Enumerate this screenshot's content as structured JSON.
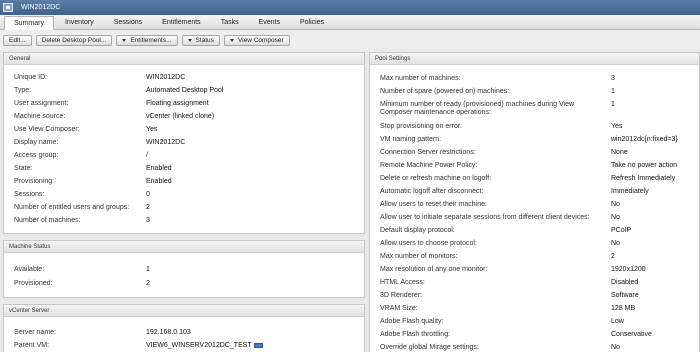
{
  "window": {
    "title": "WIN2012DC"
  },
  "tabs": [
    "Summary",
    "Inventory",
    "Sessions",
    "Entitlements",
    "Tasks",
    "Events",
    "Policies"
  ],
  "toolbar": {
    "edit": "Edit...",
    "delete": "Delete Desktop Pool...",
    "entitlements": "Entitlements...",
    "status": "Status",
    "composer": "View Composer"
  },
  "general": {
    "header": "General",
    "rows": [
      {
        "label": "Unique ID:",
        "value": "WIN2012DC"
      },
      {
        "label": "Type:",
        "value": "Automated Desktop Pool"
      },
      {
        "label": "User assignment:",
        "value": "Floating assignment"
      },
      {
        "label": "Machine source:",
        "value": "vCenter (linked clone)"
      },
      {
        "label": "Use View Composer:",
        "value": "Yes"
      },
      {
        "label": "Display name:",
        "value": "WIN2012DC"
      },
      {
        "label": "Access group:",
        "value": "/"
      },
      {
        "label": "State:",
        "value": "Enabled"
      },
      {
        "label": "Provisioning:",
        "value": "Enabled"
      },
      {
        "label": "Sessions:",
        "value": "0"
      },
      {
        "label": "Number of entitled users and groups:",
        "value": "2"
      },
      {
        "label": "Number of machines:",
        "value": "3"
      }
    ]
  },
  "machine_status": {
    "header": "Machine Status",
    "rows": [
      {
        "label": "Available:",
        "value": "1"
      },
      {
        "label": "Provisioned:",
        "value": "2"
      }
    ]
  },
  "vcenter": {
    "header": "vCenter Server",
    "rows": [
      {
        "label": "Server name:",
        "value": "192.168.0.103"
      },
      {
        "label": "Parent VM:",
        "value": "VIEW6_WINSERV2012DC_TEST"
      }
    ]
  },
  "pool_settings": {
    "header": "Pool Settings",
    "rows": [
      {
        "label": "Max number of machines:",
        "value": "3"
      },
      {
        "label": "Number of spare (powered on) machines:",
        "value": "1"
      },
      {
        "label": "Minimum number of ready (provisioned) machines during View Composer maintenance operations:",
        "value": "1"
      },
      {
        "label": "Stop provisioning on error:",
        "value": "Yes"
      },
      {
        "label": "VM naming pattern:",
        "value": "win2012dc{n:fixed=3}"
      },
      {
        "label": "Connection Server restrictions:",
        "value": "None"
      },
      {
        "label": "Remote Machine Power Policy:",
        "value": "Take no power action"
      },
      {
        "label": "Delete or refresh machine on logoff:",
        "value": "Refresh Immediately"
      },
      {
        "label": "Automatic logoff after disconnect:",
        "value": "Immediately"
      },
      {
        "label": "Allow users to reset their machine:",
        "value": "No"
      },
      {
        "label": "Allow user to initiate separate sessions from different client devices:",
        "value": "No"
      },
      {
        "label": "Default display protocol:",
        "value": "PCoIP"
      },
      {
        "label": "Allow users to choose protocol:",
        "value": "No"
      },
      {
        "label": "Max number of monitors:",
        "value": "2"
      },
      {
        "label": "Max resolution of any one monitor:",
        "value": "1920x1200"
      },
      {
        "label": "HTML Access:",
        "value": "Disabled"
      },
      {
        "label": "3D Renderer:",
        "value": "Software"
      },
      {
        "label": "VRAM Size:",
        "value": "128 MB"
      },
      {
        "label": "Adobe Flash quality:",
        "value": "Low"
      },
      {
        "label": "Adobe Flash throttling:",
        "value": "Conservative"
      },
      {
        "label": "Override global Mirage settings:",
        "value": "No"
      }
    ]
  }
}
